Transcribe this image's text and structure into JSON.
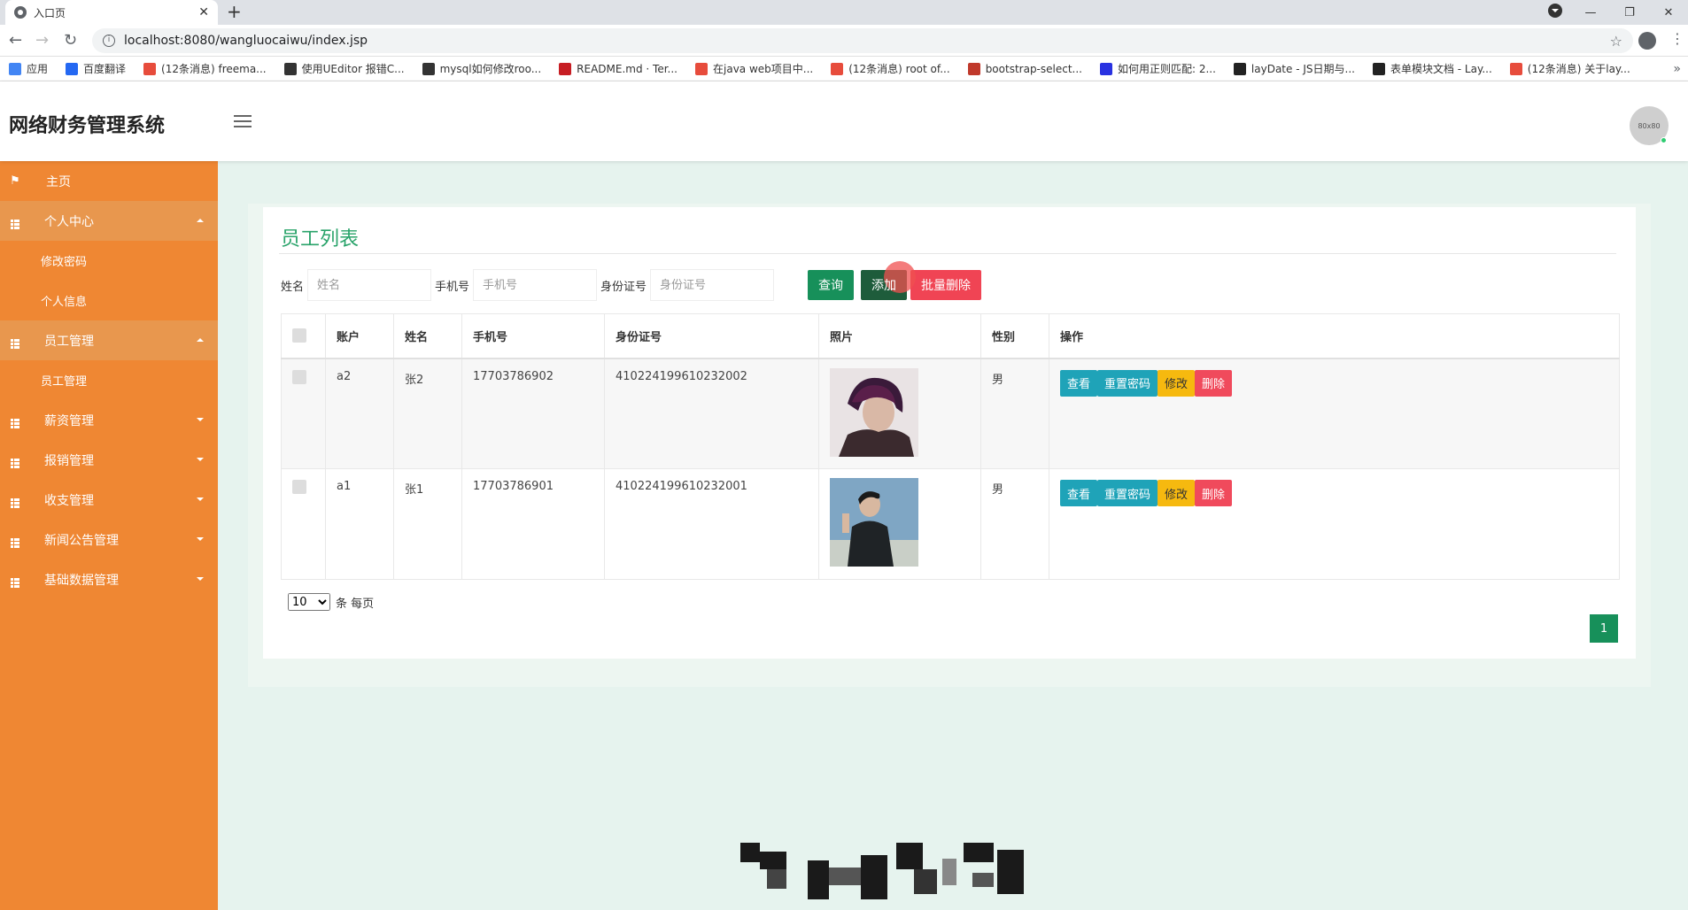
{
  "browser": {
    "tab_title": "入口页",
    "url": "localhost:8080/wangluocaiwu/index.jsp",
    "bookmarks": [
      {
        "label": "应用",
        "icon": "apps-grid-icon",
        "color": "#4285f4"
      },
      {
        "label": "百度翻译",
        "icon": "baidu-translate-icon",
        "color": "#2468f2"
      },
      {
        "label": "(12条消息) freema...",
        "icon": "csdn-icon",
        "color": "#e74c3c"
      },
      {
        "label": "使用UEditor 报错C...",
        "icon": "ueditor-icon",
        "color": "#333333"
      },
      {
        "label": "mysql如何修改roo...",
        "icon": "mysql-icon",
        "color": "#333333"
      },
      {
        "label": "README.md · Ter...",
        "icon": "gitee-icon",
        "color": "#c71d23"
      },
      {
        "label": "在java web项目中...",
        "icon": "csdn-icon",
        "color": "#e74c3c"
      },
      {
        "label": "(12条消息) root of...",
        "icon": "csdn-icon",
        "color": "#e74c3c"
      },
      {
        "label": "bootstrap-select...",
        "icon": "bookmark-icon",
        "color": "#c0392b"
      },
      {
        "label": "如何用正则匹配: 2...",
        "icon": "baidu-icon",
        "color": "#2932e1"
      },
      {
        "label": "layDate - JS日期与...",
        "icon": "layui-icon",
        "color": "#222222"
      },
      {
        "label": "表单模块文档 - Lay...",
        "icon": "layui-icon",
        "color": "#222222"
      },
      {
        "label": "(12条消息) 关于lay...",
        "icon": "csdn-icon",
        "color": "#e74c3c"
      }
    ]
  },
  "header": {
    "brand": "网络财务管理系统",
    "avatar_text": "80x80"
  },
  "sidebar": {
    "items": [
      {
        "label": "主页",
        "icon": "flag-icon"
      },
      {
        "label": "个人中心",
        "icon": "grid-icon",
        "expanded": true,
        "children": [
          {
            "label": "修改密码"
          },
          {
            "label": "个人信息"
          }
        ]
      },
      {
        "label": "员工管理",
        "icon": "grid-icon",
        "expanded": true,
        "children": [
          {
            "label": "员工管理"
          }
        ]
      },
      {
        "label": "薪资管理",
        "icon": "grid-icon",
        "expanded": false
      },
      {
        "label": "报销管理",
        "icon": "grid-icon",
        "expanded": false
      },
      {
        "label": "收支管理",
        "icon": "grid-icon",
        "expanded": false
      },
      {
        "label": "新闻公告管理",
        "icon": "grid-icon",
        "expanded": false
      },
      {
        "label": "基础数据管理",
        "icon": "grid-icon",
        "expanded": false
      }
    ]
  },
  "main": {
    "title": "员工列表",
    "search": {
      "name_label": "姓名",
      "name_placeholder": "姓名",
      "phone_label": "手机号",
      "phone_placeholder": "手机号",
      "id_label": "身份证号",
      "id_placeholder": "身份证号"
    },
    "buttons": {
      "query": "查询",
      "add": "添加",
      "batch_delete": "批量删除"
    },
    "table": {
      "columns": [
        "账户",
        "姓名",
        "手机号",
        "身份证号",
        "照片",
        "性别",
        "操作"
      ],
      "rows": [
        {
          "account": "a2",
          "name": "张2",
          "phone": "17703786902",
          "id_number": "410224199610232002",
          "gender": "男"
        },
        {
          "account": "a1",
          "name": "张1",
          "phone": "17703786901",
          "id_number": "410224199610232001",
          "gender": "男"
        }
      ],
      "row_actions": {
        "view": "查看",
        "reset": "重置密码",
        "edit": "修改",
        "delete": "删除"
      }
    },
    "pagination": {
      "page_size": "10",
      "page_size_suffix": "条 每页",
      "current_page": "1"
    }
  },
  "colors": {
    "sidebar": "#ef8733",
    "primary_green": "#17905a",
    "title_green": "#29a36a",
    "danger": "#f04454",
    "info": "#1fa3b8",
    "warning": "#f6b90f",
    "content_bg": "#e6f3ee"
  }
}
